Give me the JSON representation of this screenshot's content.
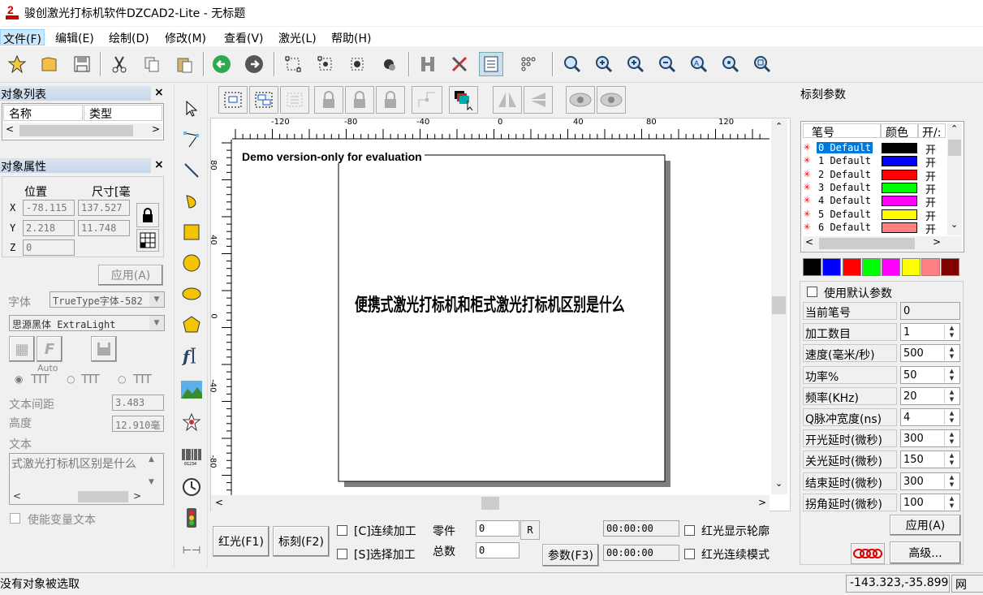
{
  "title": "骏创激光打标机软件DZCAD2-Lite  - 无标题",
  "menu": [
    "文件(F)",
    "编辑(E)",
    "绘制(D)",
    "修改(M)",
    "查看(V)",
    "激光(L)",
    "帮助(H)"
  ],
  "toolbar_icons": [
    "new-icon",
    "open-icon",
    "save-icon",
    "cut-icon",
    "copy-icon",
    "paste-icon",
    "undo-icon",
    "redo-icon",
    "node-edit-icon",
    "node-select-icon",
    "node-add-icon",
    "node-delete-icon",
    "distribute-icon",
    "tool-options-icon",
    "properties-icon",
    "grid-icon",
    "zoom-icon",
    "zoom-in-icon",
    "zoom-in-alt-icon",
    "zoom-out-icon",
    "zoom-all-icon",
    "zoom-selection-icon",
    "zoom-page-icon"
  ],
  "object_list": {
    "title": "对象列表",
    "close": "×",
    "col_name": "名称",
    "col_type": "类型"
  },
  "object_props": {
    "title": "对象属性",
    "close": "×",
    "col_pos": "位置",
    "col_size": "尺寸[毫",
    "x_label": "X",
    "y_label": "Y",
    "z_label": "Z",
    "x_pos": "-78.115",
    "x_size": "137.527",
    "y_pos": "2.218",
    "y_size": "11.748",
    "z_pos": "0",
    "apply": "应用(A)",
    "font_label": "字体",
    "font_type": "TrueType字体-582",
    "font_name": "思源黑体 ExtraLight",
    "auto": "Auto",
    "char_spacing_label": "文本间距",
    "char_spacing": "3.483",
    "height_label": "高度",
    "height": "12.910毫",
    "text_label": "文本",
    "text": "式激光打标机区别是什么",
    "variable_text": "使能变量文本"
  },
  "canvas": {
    "ruler_h": [
      "-120",
      "-80",
      "-40",
      "0",
      "40",
      "80",
      "120"
    ],
    "ruler_v": [
      "80",
      "40",
      "0",
      "-40",
      "-80"
    ],
    "watermark": "Demo version-only for evaluation",
    "content_text": "便携式激光打标机和柜式激光打标机区别是什么"
  },
  "bottom": {
    "red_light": "红光(F1)",
    "mark": "标刻(F2)",
    "continuous": "[C]连续加工",
    "select_process": "[S]选择加工",
    "parts_label": "零件",
    "parts_value": "0",
    "total_label": "总数",
    "total_value": "0",
    "r_button": "R",
    "params": "参数(F3)",
    "time1": "00:00:00",
    "time2": "00:00:00",
    "red_outline": "红光显示轮廓",
    "red_continuous": "红光连续模式"
  },
  "mark_params": {
    "title": "标刻参数",
    "col_pen": "笔号",
    "col_color": "颜色",
    "col_on": "开/:",
    "pens": [
      {
        "name": "0 Default",
        "color": "#000000",
        "on": "开"
      },
      {
        "name": "1 Default",
        "color": "#0000ff",
        "on": "开"
      },
      {
        "name": "2 Default",
        "color": "#ff0000",
        "on": "开"
      },
      {
        "name": "3 Default",
        "color": "#00ff00",
        "on": "开"
      },
      {
        "name": "4 Default",
        "color": "#ff00ff",
        "on": "开"
      },
      {
        "name": "5 Default",
        "color": "#ffff00",
        "on": "开"
      },
      {
        "name": "6 Default",
        "color": "#ff8080",
        "on": "开"
      }
    ],
    "palette": [
      "#000000",
      "#0000ff",
      "#ff0000",
      "#00ff00",
      "#ff00ff",
      "#ffff00",
      "#ff8080",
      "#800000"
    ],
    "use_default": "使用默认参数",
    "params": [
      {
        "label": "当前笔号",
        "value": "0",
        "spin": false
      },
      {
        "label": "加工数目",
        "value": "1",
        "spin": true
      },
      {
        "label": "速度(毫米/秒)",
        "value": "500",
        "spin": true
      },
      {
        "label": "功率%",
        "value": "50",
        "spin": true
      },
      {
        "label": "频率(KHz)",
        "value": "20",
        "spin": true
      },
      {
        "label": "Q脉冲宽度(ns)",
        "value": "4",
        "spin": true
      },
      {
        "label": "开光延时(微秒)",
        "value": "300",
        "spin": true
      },
      {
        "label": "关光延时(微秒)",
        "value": "150",
        "spin": true
      },
      {
        "label": "结束延时(微秒)",
        "value": "300",
        "spin": true
      },
      {
        "label": "拐角延时(微秒)",
        "value": "100",
        "spin": true
      }
    ],
    "apply": "应用(A)",
    "advanced": "高级..."
  },
  "status": {
    "message": "没有对象被选取",
    "coords": "-143.323,-35.899",
    "grid": "网格:"
  }
}
